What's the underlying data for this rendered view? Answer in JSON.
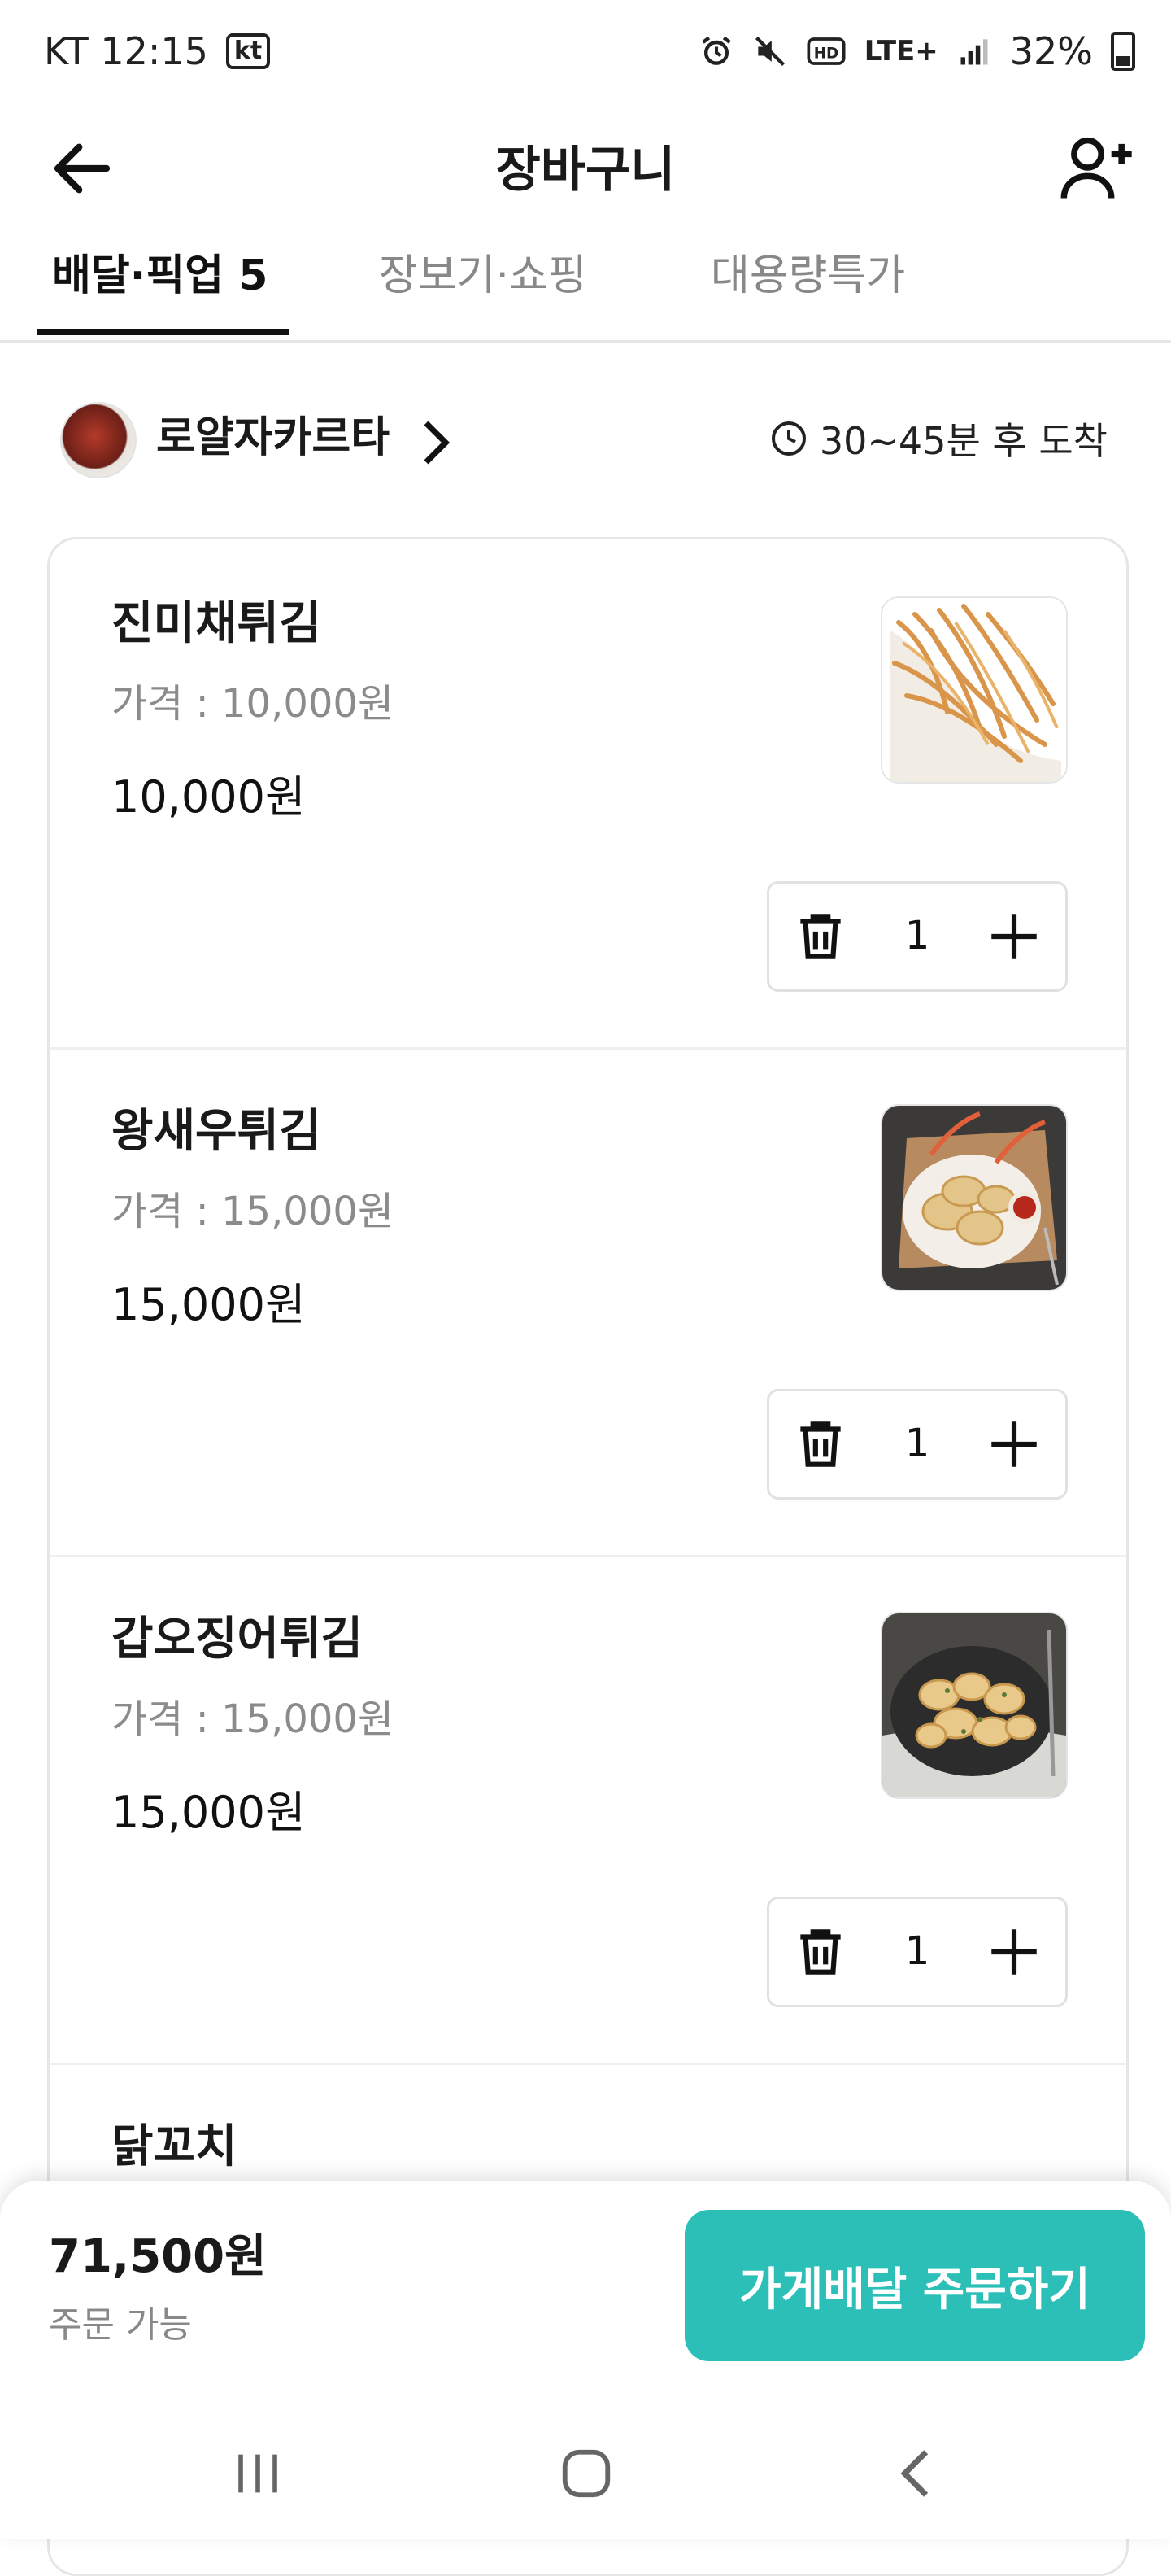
{
  "status_bar": {
    "carrier_time": "KT 12:15",
    "carrier_badge": "kt",
    "network": "LTE+",
    "battery": "32%"
  },
  "header": {
    "title": "장바구니"
  },
  "tabs": [
    {
      "label": "배달·픽업 5",
      "active": true
    },
    {
      "label": "장보기·쇼핑",
      "active": false
    },
    {
      "label": "대용량특가",
      "active": false
    }
  ],
  "store": {
    "name": "로얄자카르타",
    "eta": "30~45분 후 도착"
  },
  "cart_items": [
    {
      "name": "진미채튀김",
      "price_label": "가격 : 10,000원",
      "total": "10,000원",
      "quantity": "1",
      "image_icon": "fried-squid-strips-photo"
    },
    {
      "name": "왕새우튀김",
      "price_label": "가격 : 15,000원",
      "total": "15,000원",
      "quantity": "1",
      "image_icon": "fried-shrimp-photo"
    },
    {
      "name": "갑오징어튀김",
      "price_label": "가격 : 15,000원",
      "total": "15,000원",
      "quantity": "1",
      "image_icon": "fried-cuttlefish-photo"
    },
    {
      "name": "닭꼬치"
    }
  ],
  "order": {
    "total": "71,500원",
    "status": "주문 가능",
    "button_label": "가게배달 주문하기"
  },
  "colors": {
    "accent": "#2bbfb7",
    "text_primary": "#1a1a1a",
    "text_secondary": "#8b8b8b"
  }
}
